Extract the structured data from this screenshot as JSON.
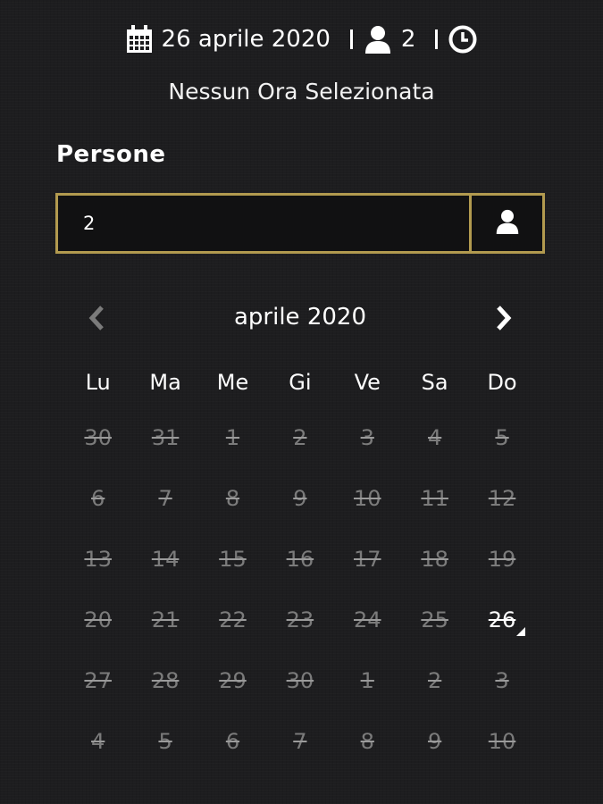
{
  "summary": {
    "date": "26 aprile 2020",
    "persons": "2",
    "time_status": "Nessun Ora Selezionata",
    "icons": [
      "calendar-icon",
      "user-icon",
      "clock-icon"
    ]
  },
  "persons_field": {
    "label": "Persone",
    "value": "2",
    "icon": "user-icon"
  },
  "calendar": {
    "month_title": "aprile 2020",
    "prev_icon": "chevron-left-icon",
    "next_icon": "chevron-right-icon",
    "weekdays": [
      "Lu",
      "Ma",
      "Me",
      "Gi",
      "Ve",
      "Sa",
      "Do"
    ],
    "weeks": [
      [
        "30",
        "31",
        "1",
        "2",
        "3",
        "4",
        "5"
      ],
      [
        "6",
        "7",
        "8",
        "9",
        "10",
        "11",
        "12"
      ],
      [
        "13",
        "14",
        "15",
        "16",
        "17",
        "18",
        "19"
      ],
      [
        "20",
        "21",
        "22",
        "23",
        "24",
        "25",
        "26"
      ],
      [
        "27",
        "28",
        "29",
        "30",
        "1",
        "2",
        "3"
      ],
      [
        "4",
        "5",
        "6",
        "7",
        "8",
        "9",
        "10"
      ]
    ],
    "selected_day": "26"
  },
  "colors": {
    "background": "#1d1d1f",
    "accent_border": "#b29a4f",
    "disabled_day": "#7b7b7b",
    "text": "#ffffff"
  }
}
